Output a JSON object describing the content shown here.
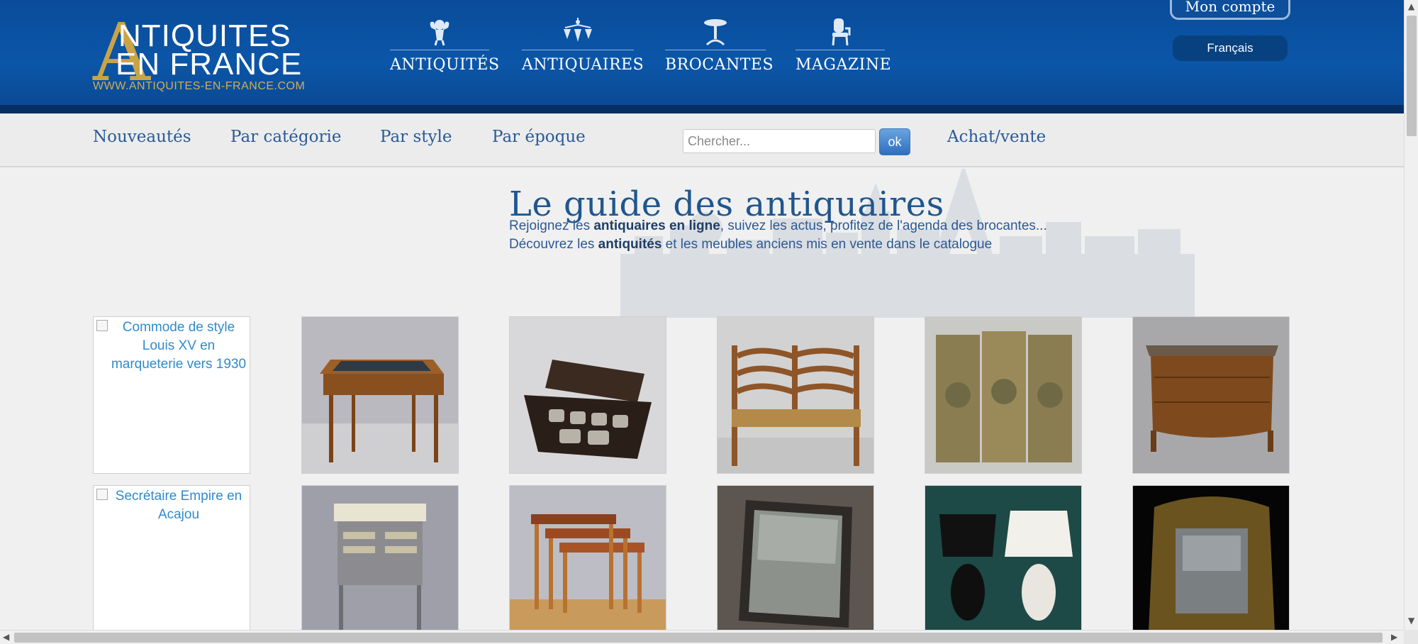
{
  "header": {
    "logo_initial": "A",
    "logo_line1": "NTIQUITES",
    "logo_line2": "EN FRANCE",
    "logo_url": "WWW.ANTIQUITES-EN-FRANCE.COM",
    "nav": [
      {
        "label": "ANTIQUITÉS",
        "icon": "cherub-icon"
      },
      {
        "label": "ANTIQUAIRES",
        "icon": "chandelier-icon"
      },
      {
        "label": "BROCANTES",
        "icon": "pedestal-table-icon"
      },
      {
        "label": "MAGAZINE",
        "icon": "armchair-icon"
      }
    ],
    "account_label": "Mon compte",
    "language_label": "Français"
  },
  "subnav": {
    "links": [
      "Nouveautés",
      "Par catégorie",
      "Par style",
      "Par époque"
    ],
    "search_placeholder": "Chercher...",
    "search_button": "ok",
    "buy_sell_label": "Achat/vente"
  },
  "hero": {
    "title": "Le guide des antiquaires",
    "line1_pre": "Rejoignez les ",
    "line1_bold": "antiquaires en ligne",
    "line1_post": ", suivez les actus, profitez de l'agenda des brocantes...",
    "line2_pre": "Découvrez les ",
    "line2_bold": "antiquités",
    "line2_post": " et les meubles anciens mis en vente dans le catalogue"
  },
  "grid": {
    "row1_alt": "Commode de style Louis XV en marqueterie vers 1930",
    "row2_alt": "Secrétaire Empire en Acajou",
    "row1_items": [
      "writing-desk-photo",
      "toiletry-box-photo",
      "rush-bench-photo",
      "painted-screen-photo",
      "commode-photo"
    ],
    "row2_items": [
      "steel-vanity-photo",
      "nesting-tables-photo",
      "mirror-photo",
      "pineapple-lamps-photo",
      "gilt-mirror-photo"
    ]
  },
  "colors": {
    "header_blue": "#0b56a8",
    "header_dark": "#062f63",
    "gold": "#c9a447",
    "link_blue": "#2a5a96"
  }
}
